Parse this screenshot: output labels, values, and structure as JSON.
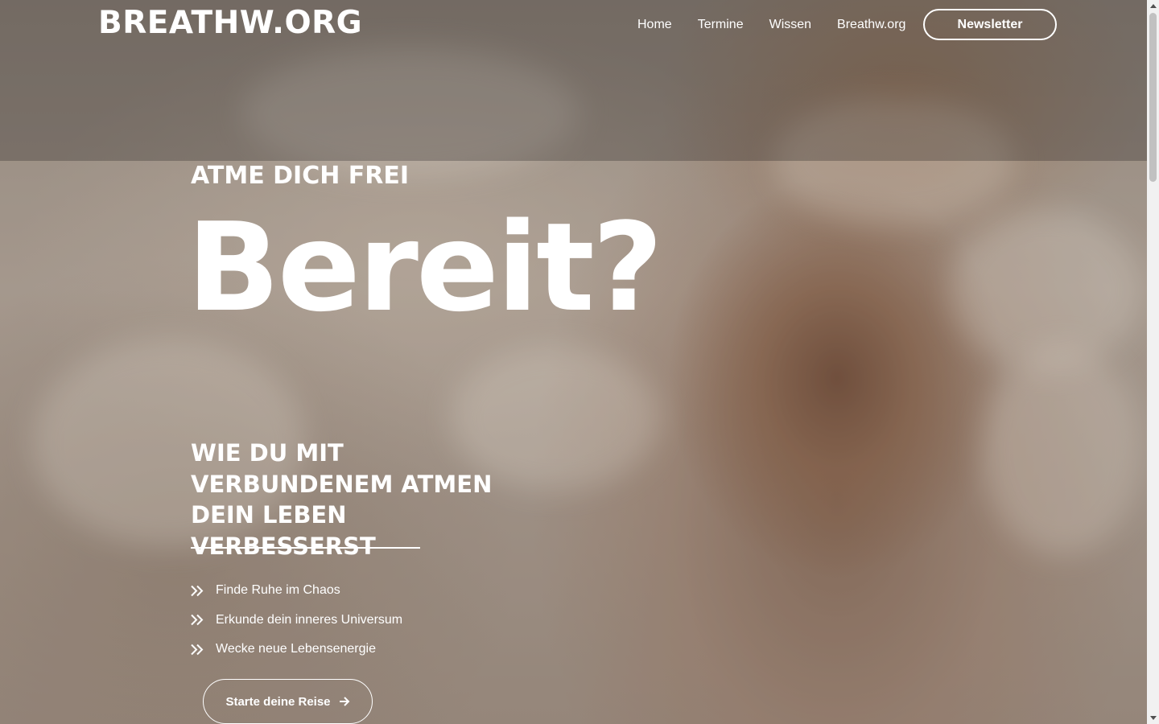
{
  "header": {
    "logo": "BREATHW.ORG",
    "nav": [
      "Home",
      "Termine",
      "Wissen",
      "Breathw.org"
    ],
    "newsletter_label": "Newsletter"
  },
  "hero": {
    "eyebrow": "ATME DICH FREI",
    "headline": "Bereit?",
    "subhead": "WIE DU MIT VERBUNDENEM ATMEN DEIN LEBEN VERBESSERST",
    "features": [
      "Finde Ruhe im Chaos",
      "Erkunde dein inneres Universum",
      "Wecke neue Lebensenergie"
    ],
    "feature_icon": "double-chevron-right-icon",
    "cta_label": "Starte deine Reise",
    "cta_icon": "arrow-right-icon"
  },
  "colors": {
    "text": "#ffffff",
    "overlay_top": "#46413e"
  }
}
